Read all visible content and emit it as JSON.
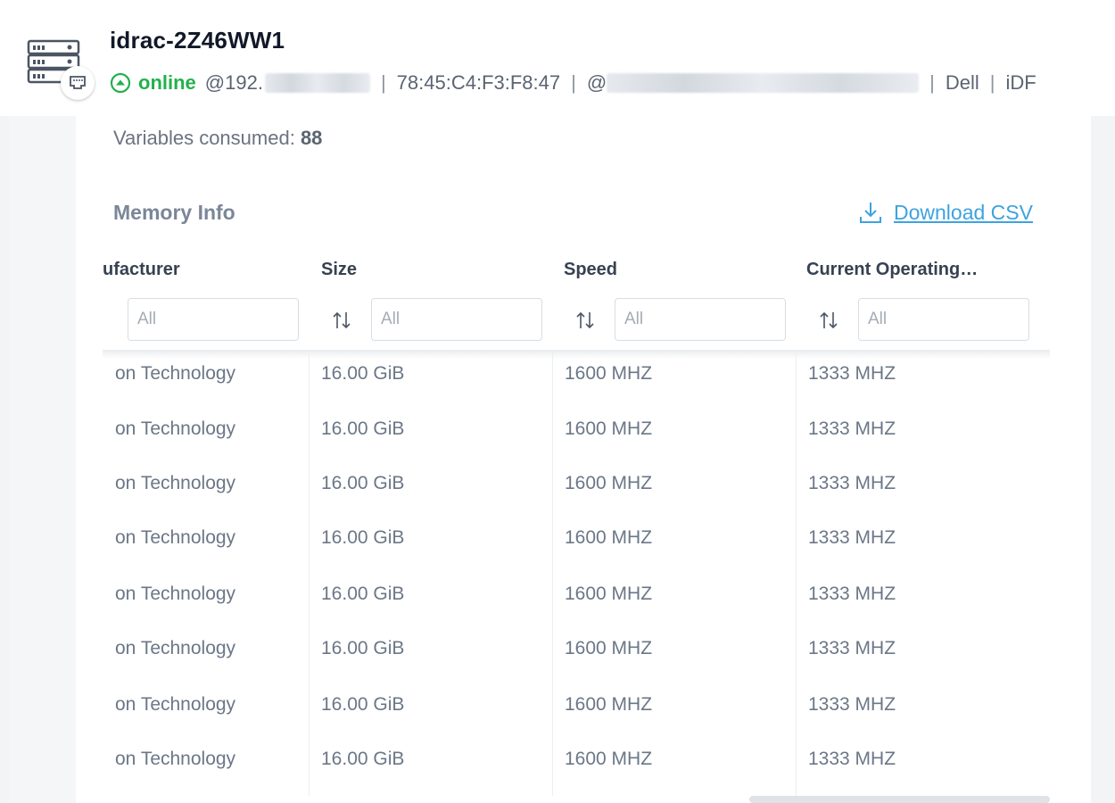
{
  "header": {
    "device_name": "idrac-2Z46WW1",
    "status": "online",
    "ip_prefix": "@192.",
    "mac": "78:45:C4:F3:F8:47",
    "location_prefix": "@",
    "vendor": "Dell",
    "model_truncated": "iDF",
    "separator": "|",
    "status_color": "#22b14c",
    "icons": [
      "server-rack-icon",
      "network-port-icon",
      "online-status-icon"
    ]
  },
  "summary": {
    "vars_label": "Variables consumed:",
    "vars_value": "88"
  },
  "memory_section": {
    "title": "Memory Info",
    "download_label": "Download CSV",
    "download_icon": "download-icon",
    "accent_color": "#3ea2e0",
    "columns": [
      {
        "label": "ufacturer",
        "filter_placeholder": "All"
      },
      {
        "label": "Size",
        "filter_placeholder": "All"
      },
      {
        "label": "Speed",
        "filter_placeholder": "All"
      },
      {
        "label": "Current Operating…",
        "filter_placeholder": "All"
      }
    ],
    "rows": [
      [
        "on Technology",
        "16.00 GiB",
        "1600 MHZ",
        "1333 MHZ"
      ],
      [
        "on Technology",
        "16.00 GiB",
        "1600 MHZ",
        "1333 MHZ"
      ],
      [
        "on Technology",
        "16.00 GiB",
        "1600 MHZ",
        "1333 MHZ"
      ],
      [
        "on Technology",
        "16.00 GiB",
        "1600 MHZ",
        "1333 MHZ"
      ],
      [
        "on Technology",
        "16.00 GiB",
        "1600 MHZ",
        "1333 MHZ"
      ],
      [
        "on Technology",
        "16.00 GiB",
        "1600 MHZ",
        "1333 MHZ"
      ],
      [
        "on Technology",
        "16.00 GiB",
        "1600 MHZ",
        "1333 MHZ"
      ],
      [
        "on Technology",
        "16.00 GiB",
        "1600 MHZ",
        "1333 MHZ"
      ]
    ]
  }
}
